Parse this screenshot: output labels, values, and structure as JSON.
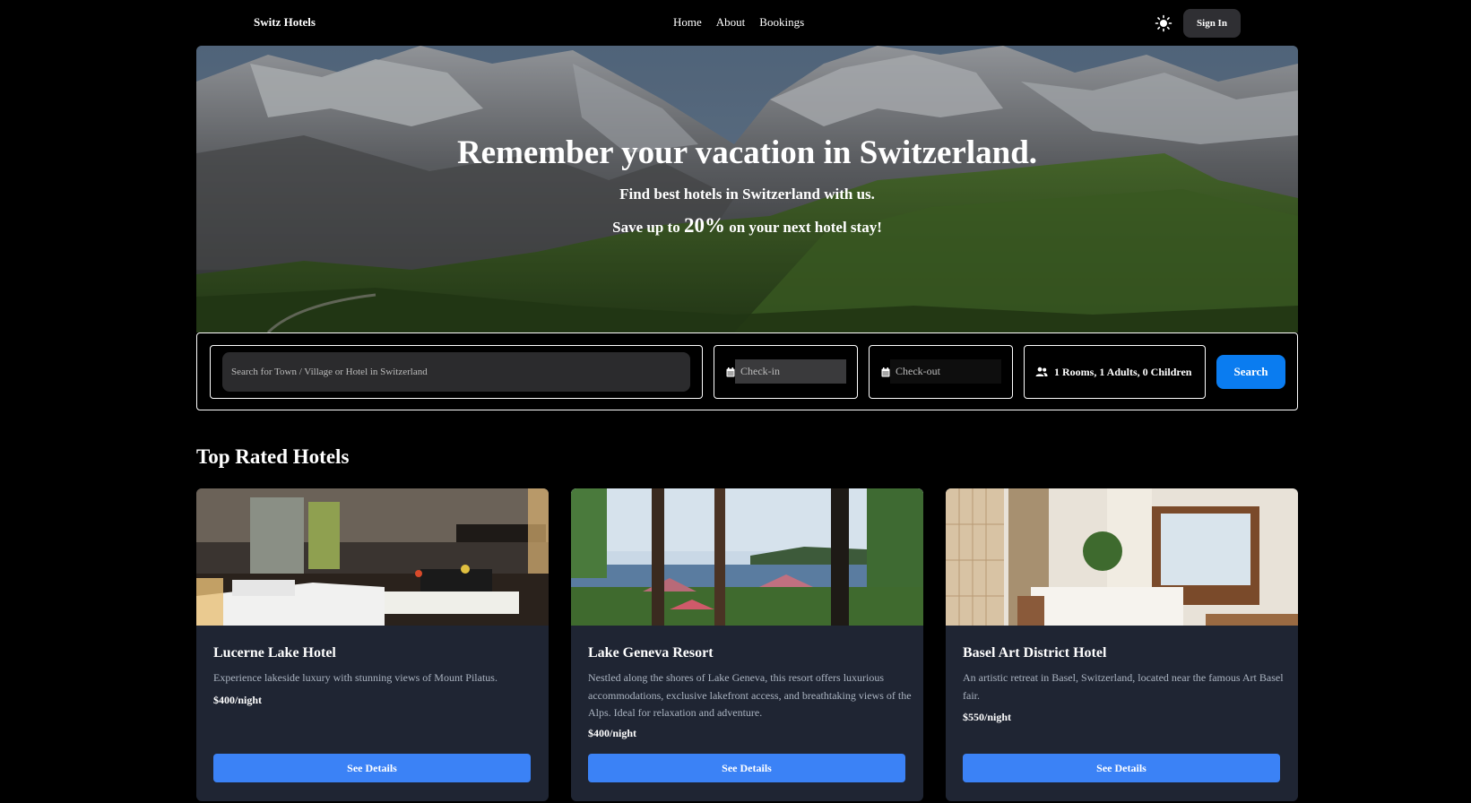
{
  "header": {
    "brand": "Switz Hotels",
    "nav": [
      "Home",
      "About",
      "Bookings"
    ],
    "theme_icon": "sun-icon",
    "signin_label": "Sign In"
  },
  "hero": {
    "title": "Remember your vacation in Switzerland.",
    "subtitle": "Find best hotels in Switzerland with us.",
    "save_prefix": "Save up to",
    "save_value": "20%",
    "save_suffix": "on your next hotel stay!"
  },
  "search": {
    "location_placeholder": "Search for Town / Village or Hotel in Switzerland",
    "checkin_placeholder": "Check-in",
    "checkout_placeholder": "Check-out",
    "guests": "1 Rooms, 1 Adults, 0 Children",
    "search_label": "Search"
  },
  "section": {
    "title": "Top Rated Hotels"
  },
  "hotels": [
    {
      "name": "Lucerne Lake Hotel",
      "description": "Experience lakeside luxury with stunning views of Mount Pilatus.",
      "price": "$400/night",
      "button": "See Details"
    },
    {
      "name": "Lake Geneva Resort",
      "description": "Nestled along the shores of Lake Geneva, this resort offers luxurious accommodations, exclusive lakefront access, and breathtaking views of the Alps. Ideal for relaxation and adventure.",
      "price": "$400/night",
      "button": "See Details"
    },
    {
      "name": "Basel Art District Hotel",
      "description": "An artistic retreat in Basel, Switzerland, located near the famous Art Basel fair.",
      "price": "$550/night",
      "button": "See Details"
    }
  ],
  "colors": {
    "accent": "#3b82f6",
    "search_button": "#0a7cf0",
    "card_bg": "#1f2533"
  }
}
